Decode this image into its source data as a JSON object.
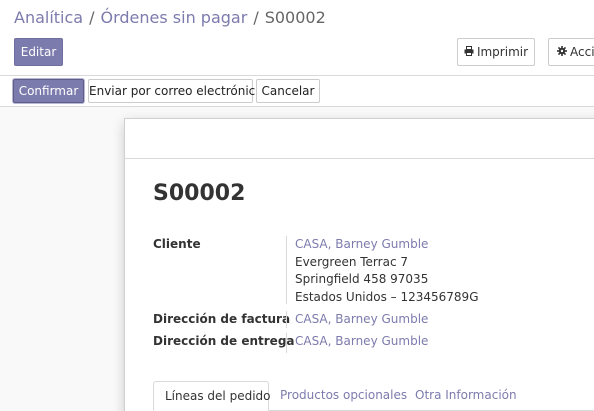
{
  "breadcrumb": {
    "items": [
      "Analítica",
      "Órdenes sin pagar"
    ],
    "separator": "/",
    "current": "S00002"
  },
  "toolbar": {
    "edit_label": "Editar",
    "print_label": "Imprimir",
    "print_icon": "print-icon",
    "action_label": "Acción",
    "action_icon": "gear-icon"
  },
  "statusbar": {
    "confirm_label": "Confirmar",
    "email_label": "Enviar por correo electrónico",
    "cancel_label": "Cancelar"
  },
  "document": {
    "title": "S00002",
    "fields": {
      "customer": {
        "label": "Cliente",
        "value": "CASA, Barney Gumble",
        "address_lines": [
          "Evergreen Terrac 7",
          "Springfield 458 97035",
          "Estados Unidos – 123456789G"
        ]
      },
      "invoice_address": {
        "label": "Dirección de factura",
        "value": "CASA, Barney Gumble"
      },
      "delivery_address": {
        "label": "Dirección de entrega",
        "value": "CASA, Barney Gumble"
      }
    }
  },
  "tabs": [
    {
      "label": "Líneas del pedido",
      "active": true
    },
    {
      "label": "Productos opcionales",
      "active": false
    },
    {
      "label": "Otra Información",
      "active": false
    }
  ],
  "colors": {
    "accent": "#7c7bad",
    "text": "#333333",
    "border": "#d9d9d9"
  }
}
